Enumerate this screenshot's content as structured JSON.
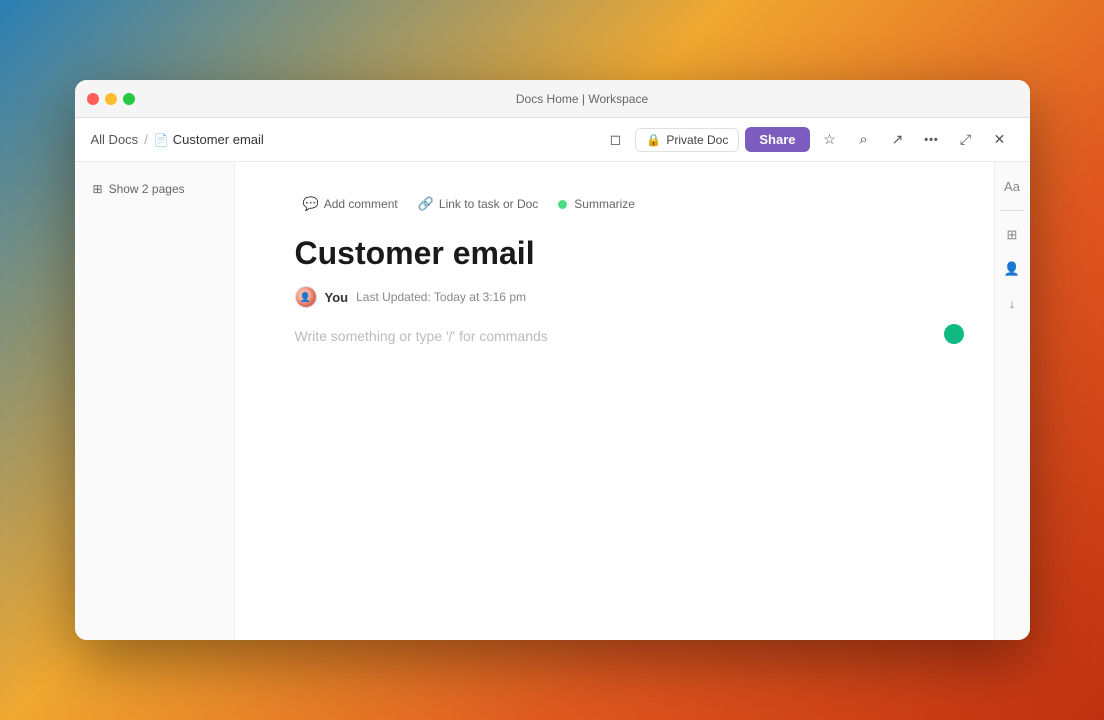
{
  "window": {
    "title": "Docs Home | Workspace"
  },
  "titlebar": {
    "title": "Docs Home | Workspace"
  },
  "breadcrumb": {
    "all_docs": "All Docs",
    "separator": "/",
    "current": "Customer email",
    "doc_icon": "📄"
  },
  "toolbar": {
    "private_doc_label": "Private Doc",
    "share_label": "Share",
    "lock_icon": "🔒",
    "star_icon": "☆",
    "search_icon": "⌕",
    "export_icon": "↗",
    "more_icon": "•••",
    "fullscreen_icon": "⤢",
    "close_icon": "✕"
  },
  "sidebar": {
    "show_pages_label": "Show 2 pages",
    "pages_icon": "⊞"
  },
  "doc": {
    "title": "Customer email",
    "author": "You",
    "last_updated": "Last Updated: Today at 3:16 pm",
    "placeholder": "Write something or type '/' for commands",
    "comment_btn": "Add comment",
    "link_btn": "Link to task or Doc",
    "summarize_btn": "Summarize"
  },
  "right_sidebar": {
    "font_icon": "Aa",
    "grid_icon": "⊞",
    "users_icon": "👤",
    "download_icon": "↓"
  },
  "colors": {
    "share_btn_bg": "#7c5cbf",
    "summarize_dot": "#4ade80",
    "cursor_dot": "#10b981"
  }
}
